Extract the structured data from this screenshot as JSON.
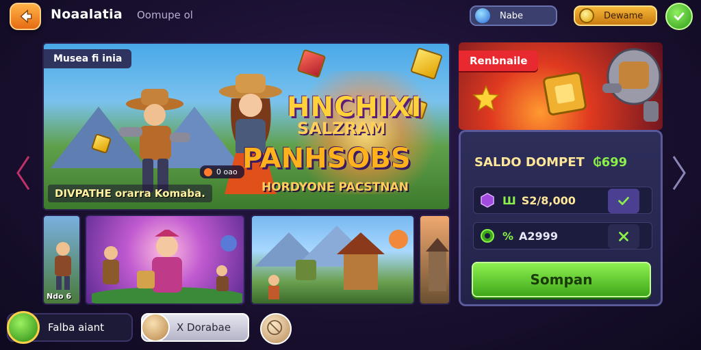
{
  "header": {
    "title": "Noaalatia",
    "subtitle": "Oomupe ol",
    "news_label": "Nabe",
    "coins_label": "Dewame"
  },
  "banner": {
    "tag": "Musea fi inia",
    "headline_1": "HNCHIXI",
    "headline_2": "SALZRAM",
    "headline_3": "PANHSOBS",
    "headline_4": "HORDYONE PACSTNAN",
    "caption": "DIVPATHE orarra Komaba.",
    "chip": "0 oao"
  },
  "thumbnails": [
    {
      "label": "Ndo 6"
    },
    {
      "label": ""
    },
    {
      "label": ""
    },
    {
      "label": ""
    }
  ],
  "promo": {
    "tag": "Renbnaile"
  },
  "wallet": {
    "title": "SALDO DOMPET",
    "title_amount": "699",
    "rows": [
      {
        "prefix": "Ш",
        "value": "S2/8,000"
      },
      {
        "prefix": "%",
        "value": "A2999"
      }
    ],
    "buy_label": "Sompan"
  },
  "bottom": {
    "item_1": "Falba aiant",
    "item_2": "X Dorabae"
  },
  "colors": {
    "accent_green": "#3ea81a",
    "accent_gold": "#ffd23a",
    "promo_red": "#e82a30"
  }
}
